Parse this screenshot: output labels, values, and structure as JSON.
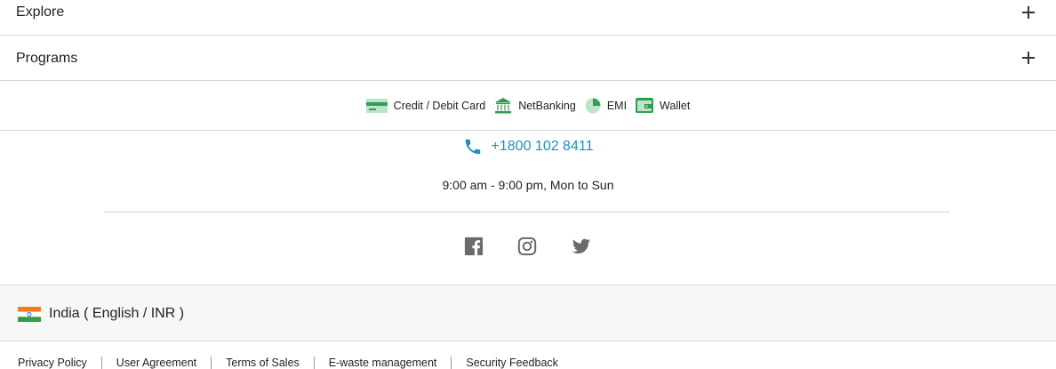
{
  "accordion": [
    {
      "label": "Explore"
    },
    {
      "label": "Programs"
    }
  ],
  "payments": [
    {
      "label": "Credit / Debit Card",
      "icon": "card-icon"
    },
    {
      "label": "NetBanking",
      "icon": "bank-icon"
    },
    {
      "label": "EMI",
      "icon": "emi-icon"
    },
    {
      "label": "Wallet",
      "icon": "wallet-icon"
    }
  ],
  "contact": {
    "phone": "+1800 102 8411",
    "hours": "9:00 am - 9:00 pm, Mon to Sun"
  },
  "social": [
    "facebook-icon",
    "instagram-icon",
    "twitter-icon"
  ],
  "locale": {
    "label": "India ( English / INR )"
  },
  "legal_links": [
    "Privacy Policy",
    "User Agreement",
    "Terms of Sales",
    "E-waste management",
    "Security Feedback"
  ],
  "colors": {
    "accent": "#1f8fb8",
    "payment_green": "#2e9e54"
  }
}
